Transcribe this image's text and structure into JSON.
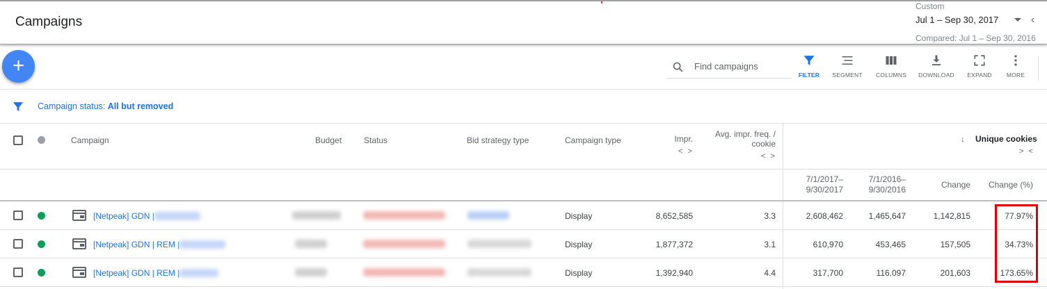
{
  "header": {
    "title": "Campaigns",
    "date_label": "Custom",
    "date_range": "Jul 1 – Sep 30, 2017",
    "compared": "Compared: Jul 1 – Sep 30, 2016"
  },
  "fab": {
    "label": "+"
  },
  "search": {
    "placeholder": "Find campaigns"
  },
  "toolbar": {
    "items": [
      {
        "label": "FILTER",
        "icon": "filter-icon",
        "active": true
      },
      {
        "label": "SEGMENT",
        "icon": "segment-icon"
      },
      {
        "label": "COLUMNS",
        "icon": "columns-icon"
      },
      {
        "label": "DOWNLOAD",
        "icon": "download-icon"
      },
      {
        "label": "EXPAND",
        "icon": "expand-icon"
      },
      {
        "label": "MORE",
        "icon": "more-vert-icon"
      }
    ],
    "active_color": "#1a73e8"
  },
  "filter": {
    "prefix": "Campaign status: ",
    "value": "All but removed"
  },
  "table": {
    "headers": {
      "campaign": "Campaign",
      "budget": "Budget",
      "status": "Status",
      "bid_strategy": "Bid strategy type",
      "campaign_type": "Campaign type",
      "impr": "Impr.",
      "avg_freq_1": "Avg. impr. freq. /",
      "avg_freq_2": "cookie",
      "unique_cookies": "Unique cookies",
      "sort_arrow": "↓",
      "collapse": "> <",
      "expand": "< >"
    },
    "subheaders": {
      "period1_a": "7/1/2017–",
      "period1_b": "9/30/2017",
      "period2_a": "7/1/2016–",
      "period2_b": "9/30/2016",
      "change": "Change",
      "change_pct": "Change (%)"
    },
    "rows": [
      {
        "campaign": "[Netpeak] GDN | ",
        "type": "Display",
        "impr": "8,652,585",
        "freq": "3.3",
        "c2017": "2,608,462",
        "c2016": "1,465,647",
        "change": "1,142,815",
        "change_pct": "77.97%"
      },
      {
        "campaign": "[Netpeak] GDN | REM | ",
        "type": "Display",
        "impr": "1,877,372",
        "freq": "3.1",
        "c2017": "610,970",
        "c2016": "453,465",
        "change": "157,505",
        "change_pct": "34.73%"
      },
      {
        "campaign": "[Netpeak] GDN | REM | ",
        "type": "Display",
        "impr": "1,392,940",
        "freq": "4.4",
        "c2017": "317,700",
        "c2016": "116,097",
        "change": "201,603",
        "change_pct": "173.65%"
      }
    ]
  },
  "colors": {
    "accent": "#4285f4",
    "link": "#1a73e8",
    "enabled_dot": "#0f9d58",
    "highlight": "#e00000"
  }
}
